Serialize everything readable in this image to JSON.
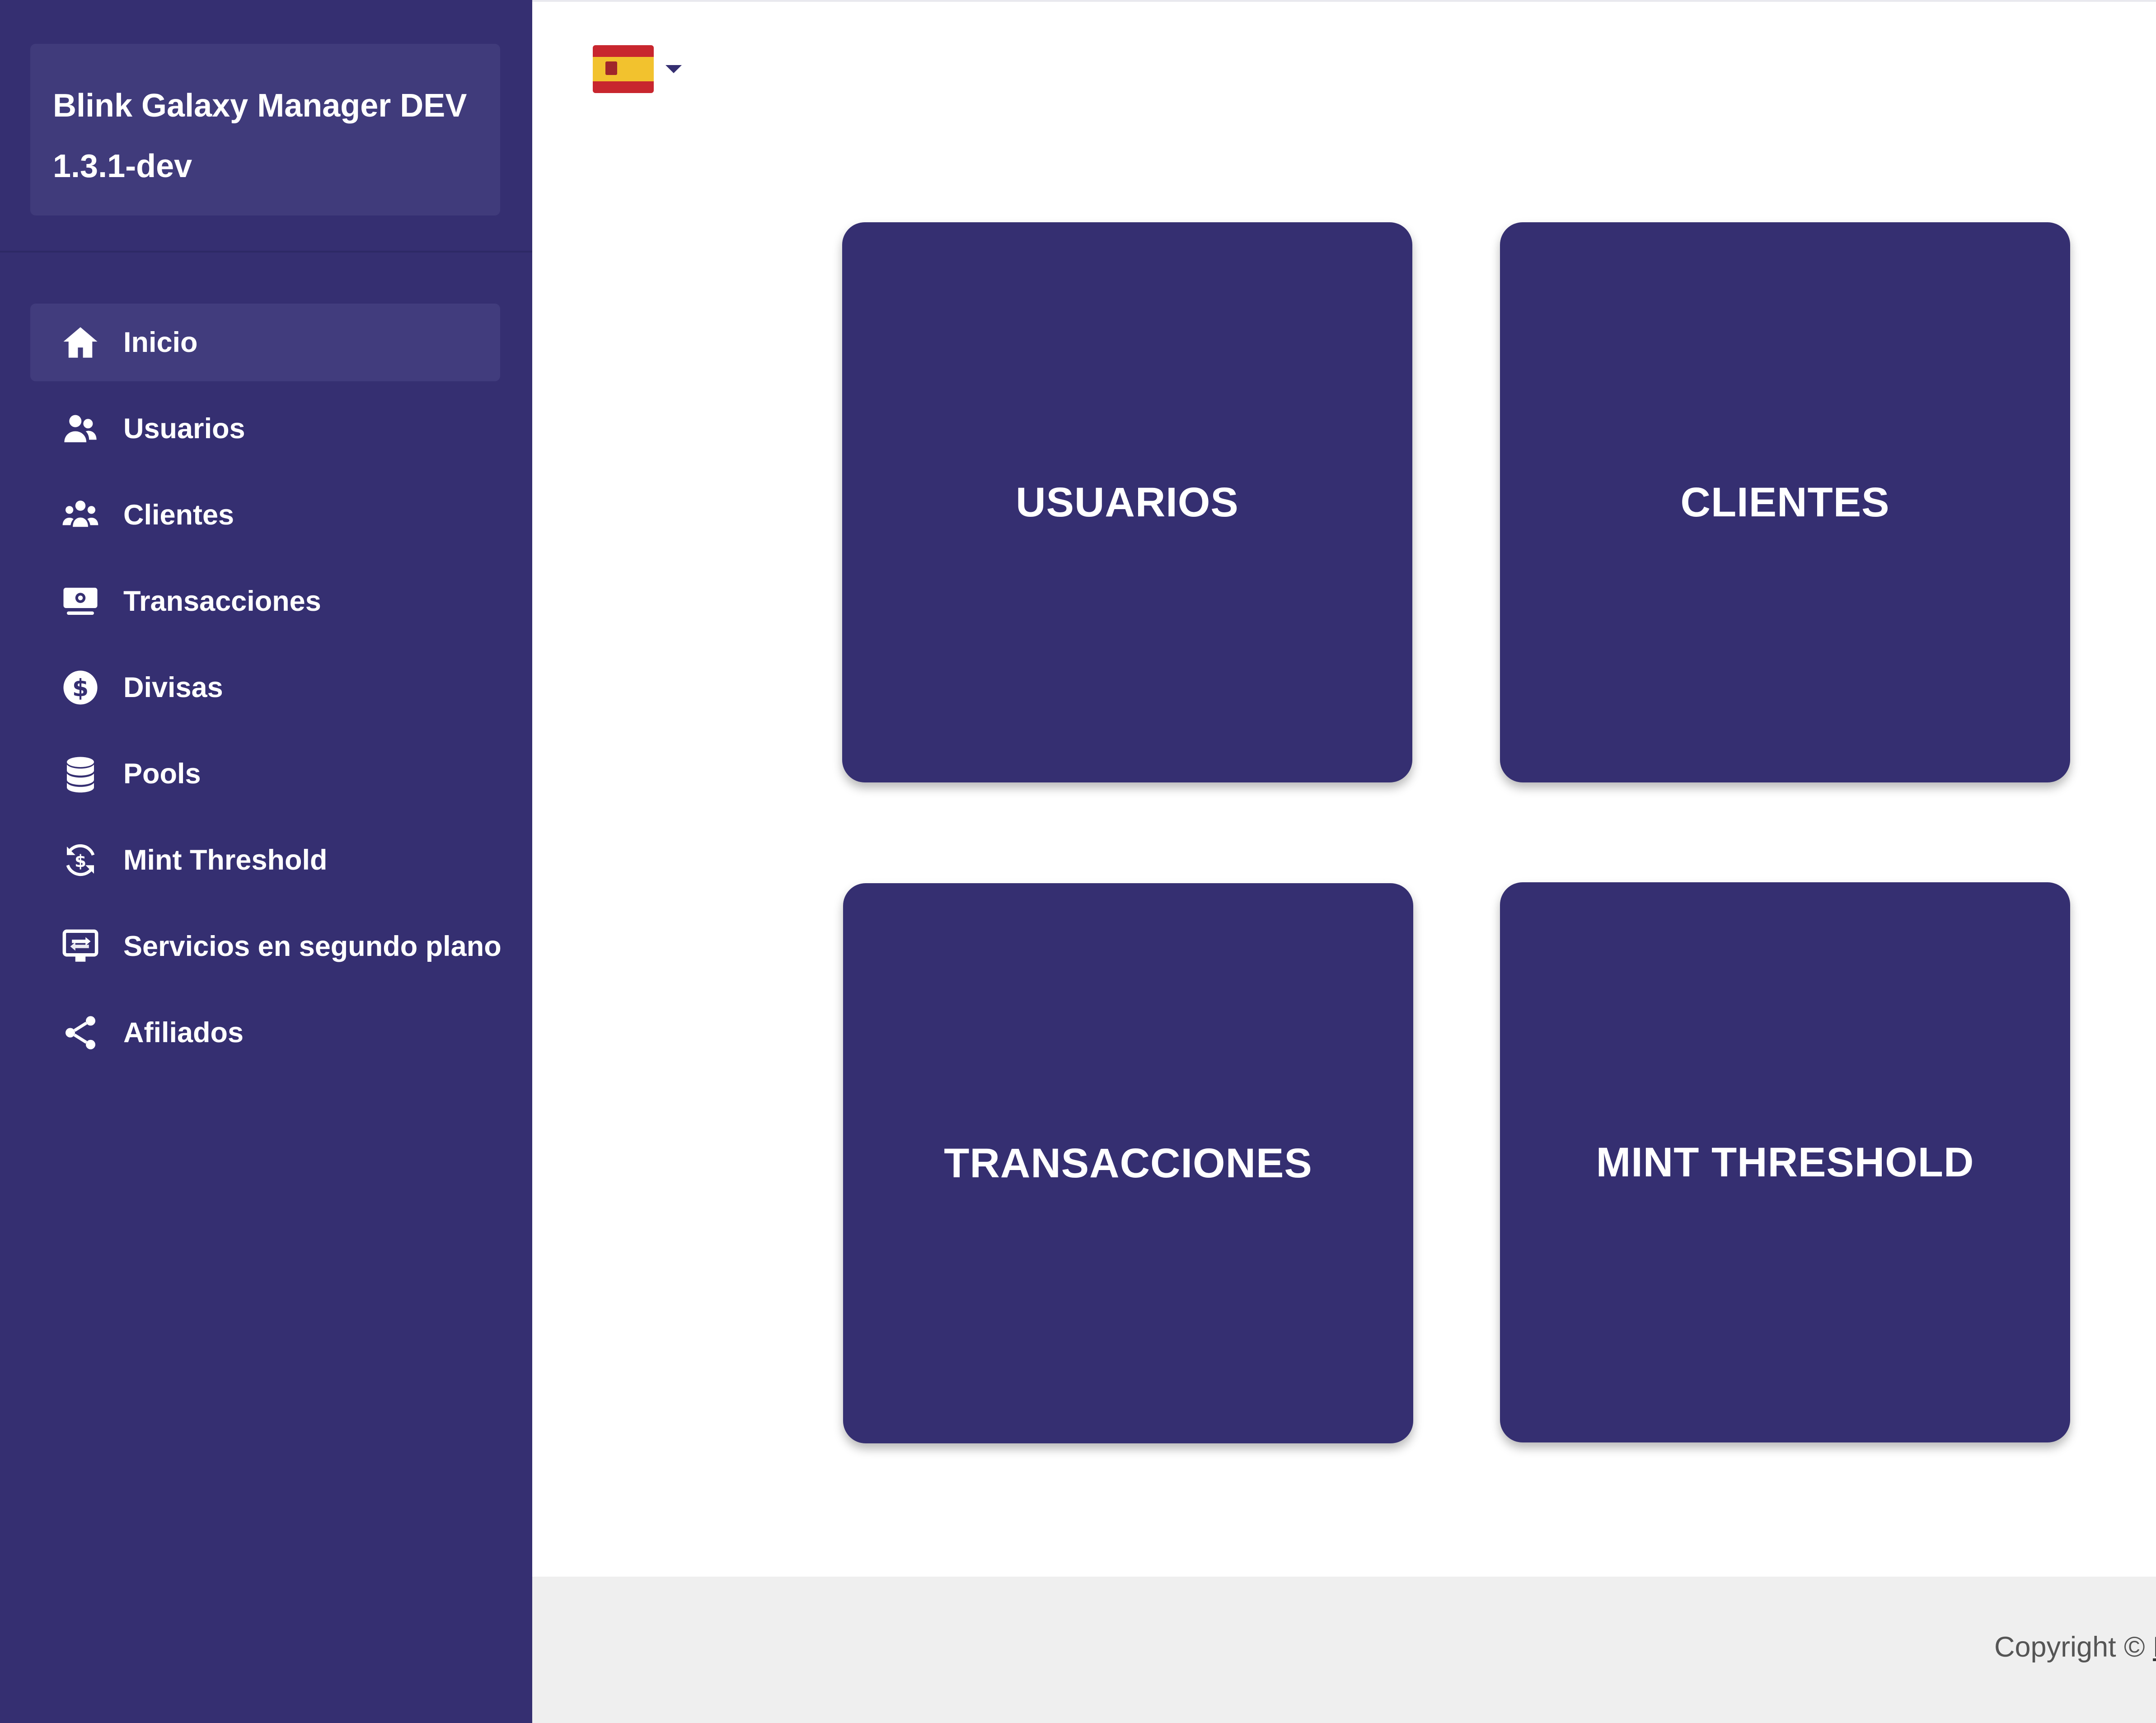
{
  "app": {
    "title_line1": "Blink Galaxy Manager DEV",
    "title_line2": "1.3.1-dev"
  },
  "sidebar": {
    "items": [
      {
        "label": "Inicio",
        "icon": "home-icon",
        "active": true
      },
      {
        "label": "Usuarios",
        "icon": "users-icon"
      },
      {
        "label": "Clientes",
        "icon": "clients-icon"
      },
      {
        "label": "Transacciones",
        "icon": "money-bill-icon"
      },
      {
        "label": "Divisas",
        "icon": "dollar-circle-icon"
      },
      {
        "label": "Pools",
        "icon": "database-icon"
      },
      {
        "label": "Mint Threshold",
        "icon": "refresh-dollar-icon"
      },
      {
        "label": "Servicios en segundo plano",
        "icon": "screen-exchange-icon"
      },
      {
        "label": "Afiliados",
        "icon": "share-icon"
      }
    ]
  },
  "header": {
    "language": {
      "flag": "spain-flag-icon",
      "dropdown_icon": "caret-down-icon"
    }
  },
  "cards": [
    {
      "label": "USUARIOS"
    },
    {
      "label": "CLIENTES"
    },
    {
      "label": "TRANSACCIONES"
    },
    {
      "label": "MINT THRESHOLD"
    }
  ],
  "footer": {
    "copyright": "Copyright ©",
    "link_text": "N"
  },
  "colors": {
    "sidebar": "#352f71",
    "card": "#352f71",
    "footer": "#efefef",
    "flag_red": "#c8262e",
    "flag_yellow": "#f2c22e"
  }
}
